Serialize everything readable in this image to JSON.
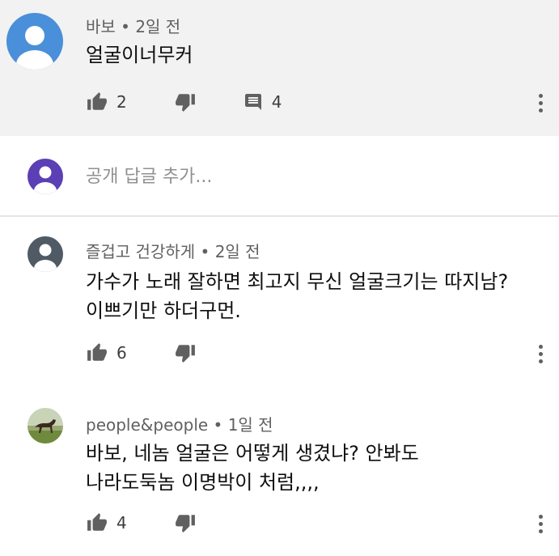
{
  "comments": [
    {
      "author": "바보",
      "time": "2일 전",
      "text_lines": [
        "얼굴이너무커"
      ],
      "likes": "2",
      "replies": "4",
      "avatar": "default-blue-avatar",
      "highlight_bg": "#f2f2f2"
    },
    {
      "author": "즐겁고 건강하게",
      "time": "2일 전",
      "text_lines": [
        "가수가 노래 잘하면 최고지 무신 얼굴크기는 따지남?",
        "이쁘기만 하더구먼."
      ],
      "likes": "6",
      "avatar": "default-gray-avatar"
    },
    {
      "author": "people&people",
      "time": "1일 전",
      "text_lines": [
        "바보, 네놈 얼굴은 어떻게  생겼냐?  안봐도",
        "나라도둑놈  이명박이 처럼,,,,"
      ],
      "likes": "4",
      "avatar": "horse-photo-avatar"
    }
  ],
  "add_comment": {
    "placeholder": "공개 답글 추가..."
  },
  "separator": "•",
  "icons": {
    "like": "thumbs-up-icon",
    "dislike": "thumbs-down-icon",
    "reply": "reply-comment-icon",
    "menu": "more-vert-icon"
  },
  "colors": {
    "blue_avatar": "#4a8fd9",
    "purple_avatar": "#5b3fb5",
    "gray_avatar": "#4f5a64"
  }
}
